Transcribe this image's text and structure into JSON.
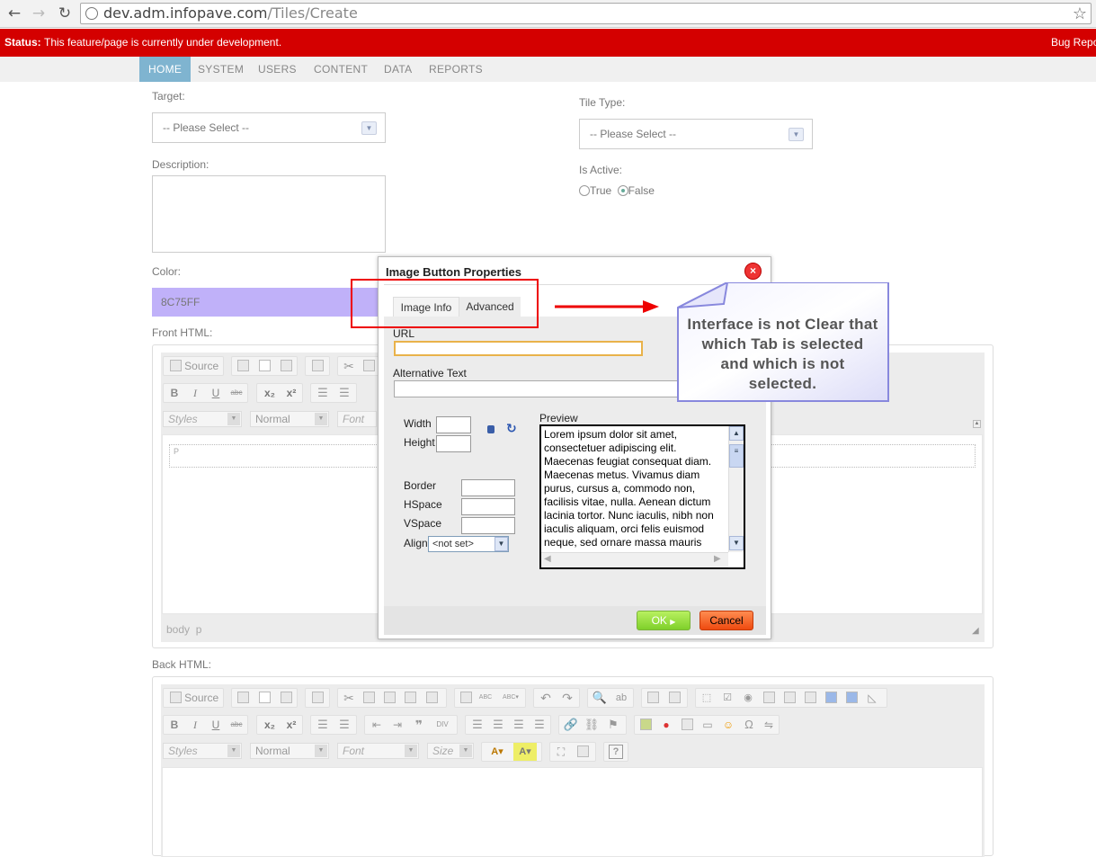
{
  "browser": {
    "back": "←",
    "forward": "→",
    "reload": "↻",
    "url_host": "dev.adm.infopave.com",
    "url_path": "/Tiles/Create",
    "star": "☆"
  },
  "status": {
    "label": "Status:",
    "message": "This feature/page is currently under development.",
    "bug_report": "Bug Repo"
  },
  "nav": [
    "HOME",
    "SYSTEM",
    "USERS",
    "CONTENT",
    "DATA",
    "REPORTS"
  ],
  "form": {
    "target_label": "Target:",
    "target_value": "-- Please Select --",
    "tile_type_label": "Tile Type:",
    "tile_type_value": "-- Please Select --",
    "description_label": "Description:",
    "is_active_label": "Is Active:",
    "is_active_true": "True",
    "is_active_false": "False",
    "is_active_selected": "False",
    "color_label": "Color:",
    "color_value": "8C75FF",
    "front_html_label": "Front HTML:",
    "back_html_label": "Back HTML:"
  },
  "editor": {
    "source": "Source",
    "bold": "B",
    "italic": "I",
    "underline": "U",
    "strike": "abc",
    "subscript": "x₂",
    "superscript": "x²",
    "styles": "Styles",
    "format": "Normal",
    "font": "Font",
    "size": "Size",
    "front_path": "body  p",
    "front_para_marker": "P"
  },
  "dialog": {
    "title": "Image Button Properties",
    "close": "×",
    "tabs": [
      "Image Info",
      "Advanced"
    ],
    "url_label": "URL",
    "alt_label": "Alternative Text",
    "width_label": "Width",
    "height_label": "Height",
    "border_label": "Border",
    "hspace_label": "HSpace",
    "vspace_label": "VSpace",
    "align_label": "Align",
    "align_value": "<not set>",
    "preview_label": "Preview",
    "preview_text": "Lorem ipsum dolor sit amet, consectetuer adipiscing elit. Maecenas feugiat consequat diam. Maecenas metus. Vivamus diam purus, cursus a, commodo non, facilisis vitae, nulla. Aenean dictum lacinia tortor. Nunc iaculis, nibh non iaculis aliquam, orci felis euismod neque, sed ornare massa mauris",
    "ok": "OK",
    "cancel": "Cancel"
  },
  "annotation": {
    "note": "Interface is not Clear that which Tab is selected and which is not selected.",
    "highlight_color": "#ee0000",
    "note_color": "#8888dd"
  },
  "colors": {
    "status_bar": "#d40000",
    "nav_active": "#7fb4d0",
    "color_swatch": "#c0b1f9"
  }
}
